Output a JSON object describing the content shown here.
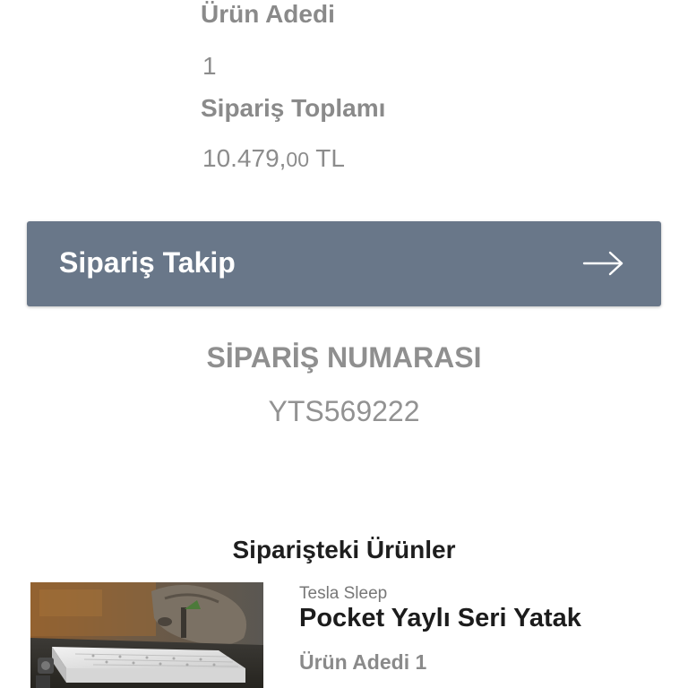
{
  "summary": {
    "quantity_label": "Ürün Adedi",
    "quantity_value": "1",
    "total_label": "Sipariş Toplamı",
    "total_value_main": "10.479,",
    "total_value_decimals": "00",
    "total_value_currency": " TL"
  },
  "tracking": {
    "button_label": "Sipariş Takip",
    "button_color": "#697789",
    "icon": "arrow-right-icon"
  },
  "order": {
    "number_title": "SİPARİŞ NUMARASI",
    "number_value": "YTS569222"
  },
  "products": {
    "heading": "Siparişteki Ürünler",
    "items": [
      {
        "brand": "Tesla Sleep",
        "name": "Pocket Yaylı Seri Yatak",
        "quantity_text": "Ürün Adedi 1",
        "image": "mattress-product-photo"
      }
    ]
  }
}
